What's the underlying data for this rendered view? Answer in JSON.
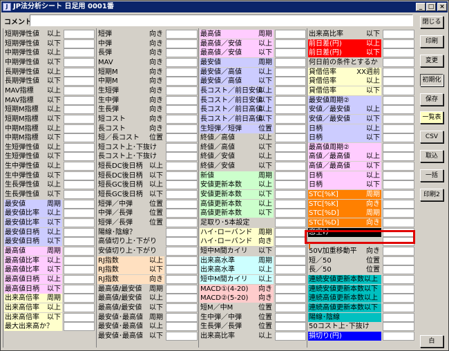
{
  "title": "JP法分析シート 日足用 0001番",
  "title_buttons": [
    "_",
    "□",
    "×"
  ],
  "comment_label": "コメント",
  "comment_value": "",
  "col1": [
    [
      "短期弾性値",
      "以上"
    ],
    [
      "短期弾性値",
      "以下"
    ],
    [
      "中期弾性値",
      "以上"
    ],
    [
      "中期弾性値",
      "以下"
    ],
    [
      "長期弾性値",
      "以上"
    ],
    [
      "長期弾性値",
      "以下"
    ],
    [
      "MAV指標",
      "以上"
    ],
    [
      "MAV指標",
      "以下"
    ],
    [
      "短期M指標",
      "以上"
    ],
    [
      "短期M指標",
      "以下"
    ],
    [
      "中期M指標",
      "以上"
    ],
    [
      "中期M指標",
      "以下"
    ],
    [
      "生短弾性値",
      "以上"
    ],
    [
      "生短弾性値",
      "以下"
    ],
    [
      "生中弾性値",
      "以上"
    ],
    [
      "生中弾性値",
      "以下"
    ],
    [
      "生長弾性値",
      "以上"
    ],
    [
      "生長弾性値",
      "以下"
    ],
    [
      "最安値",
      "周期"
    ],
    [
      "最安値比率",
      "以上"
    ],
    [
      "最安値比率",
      "以下"
    ],
    [
      "最安値日柄",
      "以上"
    ],
    [
      "最安値日柄",
      "以下"
    ],
    [
      "最高値",
      "周期"
    ],
    [
      "最高値比率",
      "以上"
    ],
    [
      "最高値比率",
      "以下"
    ],
    [
      "最高値日柄",
      "以上"
    ],
    [
      "最高値日柄",
      "以下"
    ],
    [
      "出来高倍率",
      "周期"
    ],
    [
      "出来高倍率",
      "以上"
    ],
    [
      "出来高倍率",
      "以下"
    ],
    [
      "最大出来高か？",
      ""
    ]
  ],
  "col2": [
    [
      "短弾",
      "向き"
    ],
    [
      "中弾",
      "向き"
    ],
    [
      "長弾",
      "向き"
    ],
    [
      "MAV",
      "向き"
    ],
    [
      "短期M",
      "向き"
    ],
    [
      "中期M",
      "向き"
    ],
    [
      "生短弾",
      "向き"
    ],
    [
      "生中弾",
      "向き"
    ],
    [
      "生長弾",
      "向き"
    ],
    [
      "短コスト",
      "向き"
    ],
    [
      "長コスト",
      "向き"
    ],
    [
      "短／長コスト",
      "位置"
    ],
    [
      "短コスト上･下抜け",
      ""
    ],
    [
      "長コスト上･下抜け",
      ""
    ],
    [
      "短長DC後日柄",
      "以上"
    ],
    [
      "短長DC後日柄",
      "以下"
    ],
    [
      "短長GC後日柄",
      "以上"
    ],
    [
      "短長GC後日柄",
      "以下"
    ],
    [
      "短弾／中弾",
      "位置"
    ],
    [
      "中弾／長弾",
      "位置"
    ],
    [
      "短弾／長弾",
      "位置"
    ],
    [
      "陽線･陰線？",
      ""
    ],
    [
      "高値切り上･下がり",
      ""
    ],
    [
      "安値切り上･下がり",
      ""
    ],
    [
      "RJ指数",
      "以上"
    ],
    [
      "RJ指数",
      "以下"
    ],
    [
      "RJ指数",
      "向き"
    ],
    [
      "最高値/最安値",
      "周期"
    ],
    [
      "最高値/最安値",
      "以上"
    ],
    [
      "最高値/最安値",
      "以下"
    ],
    [
      "最安値･最高値",
      "周期"
    ],
    [
      "最安値･最高値",
      "以上"
    ],
    [
      "最安値･最高値",
      "以下"
    ]
  ],
  "col3": [
    [
      "最高値",
      "周期"
    ],
    [
      "最高値／安値",
      "以上"
    ],
    [
      "最高値／安値",
      "以下"
    ],
    [
      "最安値",
      "周期"
    ],
    [
      "最安値／高値",
      "以上"
    ],
    [
      "最安値／高値",
      "以下"
    ],
    [
      "長コスト／前日安値",
      "以上"
    ],
    [
      "長コスト／前日安値",
      "以下"
    ],
    [
      "長コスト／前日高値",
      "以上"
    ],
    [
      "長コスト／前日高値",
      "以下"
    ],
    [
      "生短弾／短弾",
      "位置"
    ],
    [
      "終値／高値",
      "以上"
    ],
    [
      "終値／高値",
      "以下"
    ],
    [
      "終値／安値",
      "以上"
    ],
    [
      "終値／安値",
      "以下"
    ],
    [
      "新値",
      "周期"
    ],
    [
      "安値更新本数",
      "以上"
    ],
    [
      "安値更新本数",
      "以下"
    ],
    [
      "高値更新本数",
      "以上"
    ],
    [
      "高値更新本数",
      "以下"
    ],
    [
      "足取り･5本設定",
      ""
    ],
    [
      "ハイ･ローバンド",
      "周期"
    ],
    [
      "ハイ･ローバンド",
      "向き"
    ],
    [
      "短中M間カイリ",
      "以下"
    ],
    [
      "出来高水準",
      "周期"
    ],
    [
      "出来高水準",
      "以上"
    ],
    [
      "短中M間カイリ",
      "以上"
    ],
    [
      "MACD①(4-20)",
      "向き"
    ],
    [
      "MACD②(5-20)",
      "向き"
    ],
    [
      "短M／中M",
      "位置"
    ],
    [
      "生中弾／中弾",
      "位置"
    ],
    [
      "生長弾／長弾",
      "位置"
    ],
    [
      "出来高比率",
      "以上"
    ]
  ],
  "col4": [
    [
      "出来高比率",
      "以下"
    ],
    [
      "前日差(円)",
      "以上"
    ],
    [
      "前日差(円)",
      "以下"
    ],
    [
      "何日前の条件とするか",
      ""
    ],
    [
      "貸借倍率",
      "XX週前"
    ],
    [
      "貸借倍率",
      "以上"
    ],
    [
      "貸借倍率",
      "以下"
    ],
    [
      "最安値周期②",
      ""
    ],
    [
      "安値／最安値",
      "以上"
    ],
    [
      "安値／最安値",
      "以下"
    ],
    [
      "日柄",
      "以上"
    ],
    [
      "日柄",
      "以下"
    ],
    [
      "最高値周期②",
      ""
    ],
    [
      "高値／最高値",
      "以上"
    ],
    [
      "高値／最高値",
      "以下"
    ],
    [
      "日柄",
      "以上"
    ],
    [
      "日柄",
      "以下"
    ],
    [
      "STC[%K]",
      "周期"
    ],
    [
      "STC[%K]",
      "向き"
    ],
    [
      "STC[%D]",
      "周期"
    ],
    [
      "STC[%D]",
      "向き"
    ],
    [
      "窓空け",
      ""
    ],
    [
      "",
      ""
    ],
    [
      "50V加重移動平",
      "向き"
    ],
    [
      "短／50",
      "位置"
    ],
    [
      "長／50",
      "位置"
    ],
    [
      "連続安値更新本数以上",
      ""
    ],
    [
      "連続安値更新本数以下",
      ""
    ],
    [
      "連続高値更新本数以上",
      ""
    ],
    [
      "連続高値更新本数以下",
      ""
    ],
    [
      "陽線･陰線",
      ""
    ],
    [
      "50コスト上･下抜け",
      ""
    ],
    [
      "損切り(円)",
      ""
    ]
  ],
  "buttons": [
    "閉じる",
    "印刷",
    "変更",
    "初期化",
    "保存",
    "一覧表",
    "CSV",
    "取込",
    "一括",
    "印刷2",
    "白"
  ]
}
